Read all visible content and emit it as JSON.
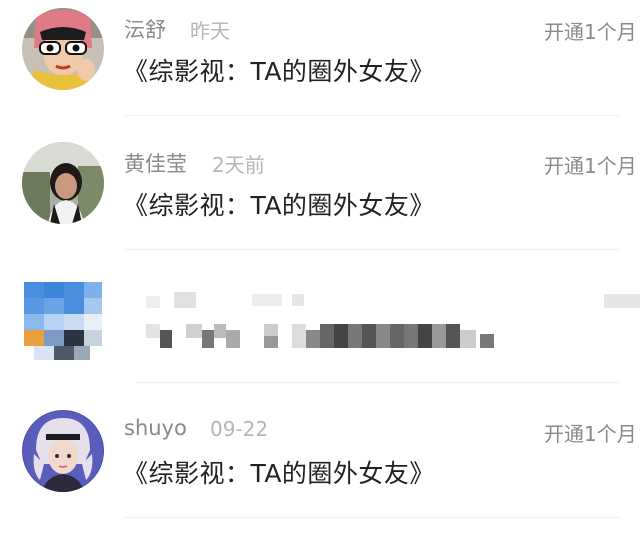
{
  "comments": [
    {
      "username": "沄舒",
      "time": "昨天",
      "vip_text": "开通1个月",
      "message": "《综影视：TA的圈外女友》",
      "avatar_icon": "user-avatar-sunglasses"
    },
    {
      "username": "黄佳莹",
      "time": "2天前",
      "vip_text": "开通1个月",
      "message": "《综影视：TA的圈外女友》",
      "avatar_icon": "user-avatar-photo"
    },
    {
      "pixelated": true,
      "avatar_icon": "pixelated-avatar"
    },
    {
      "username": "shuyo",
      "time": "09-22",
      "vip_text": "开通1个月",
      "message": "《综影视：TA的圈外女友》",
      "avatar_icon": "user-avatar-illustration"
    }
  ],
  "colors": {
    "username": "#8a8a8a",
    "time": "#b6b6b6",
    "message": "#222222",
    "divider": "#efefef"
  }
}
